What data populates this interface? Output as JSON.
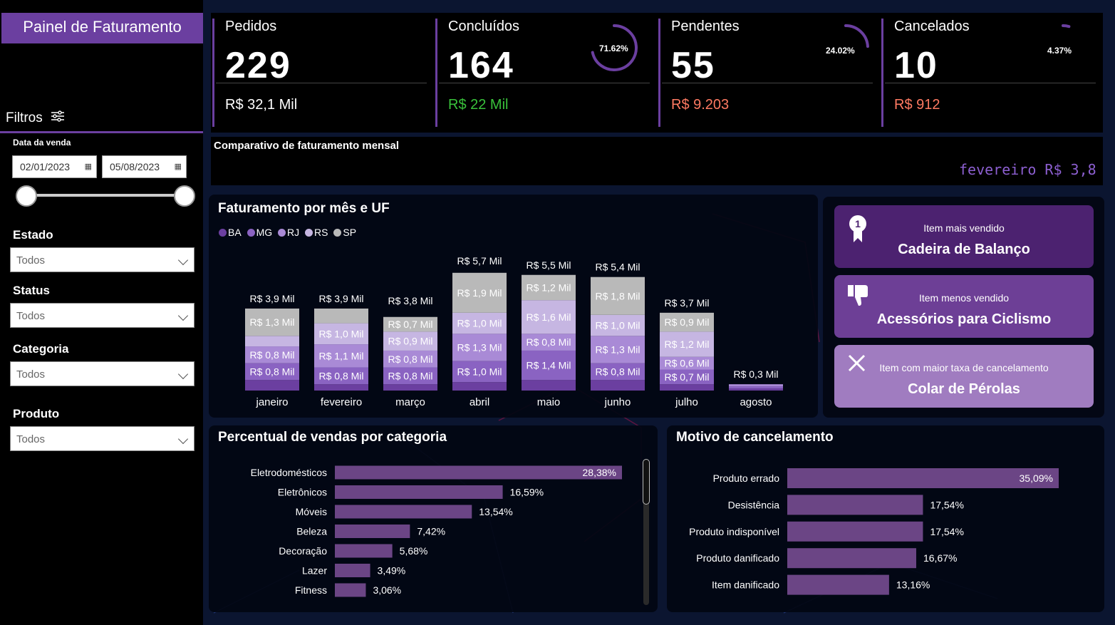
{
  "app": {
    "title": "Painel de Faturamento"
  },
  "filters": {
    "heading": "Filtros",
    "date_label": "Data da venda",
    "date_start": "02/01/2023",
    "date_end": "05/08/2023",
    "fields": [
      {
        "label": "Estado",
        "value": "Todos"
      },
      {
        "label": "Status",
        "value": "Todos"
      },
      {
        "label": "Categoria",
        "value": "Todos"
      },
      {
        "label": "Produto",
        "value": "Todos"
      }
    ]
  },
  "kpis": [
    {
      "title": "Pedidos",
      "value": "229",
      "money": "R$ 32,1 Mil",
      "money_color": "#ffffff",
      "pct": "",
      "fraction": 0
    },
    {
      "title": "Concluídos",
      "value": "164",
      "money": "R$ 22 Mil",
      "money_color": "#39c23b",
      "pct": "71.62%",
      "fraction": 0.7162
    },
    {
      "title": "Pendentes",
      "value": "55",
      "money": "R$ 9.203",
      "money_color": "#ff7a62",
      "pct": "24.02%",
      "fraction": 0.2402
    },
    {
      "title": "Cancelados",
      "value": "10",
      "money": "R$ 912",
      "money_color": "#ff7a62",
      "pct": "4.37%",
      "fraction": 0.0437
    }
  ],
  "comparativo": {
    "title": "Comparativo de faturamento mensal",
    "ticker": "fevereiro R$ 3,8"
  },
  "fat_chart": {
    "title": "Faturamento por mês e UF",
    "legend": [
      {
        "name": "BA",
        "color": "#6b3fa0"
      },
      {
        "name": "MG",
        "color": "#8a63c2"
      },
      {
        "name": "RJ",
        "color": "#a98ad6"
      },
      {
        "name": "RS",
        "color": "#c6b6e2"
      },
      {
        "name": "SP",
        "color": "#b9b9b9"
      }
    ]
  },
  "chart_data": [
    {
      "type": "bar",
      "title": "Faturamento por mês e UF",
      "categories": [
        "janeiro",
        "fevereiro",
        "março",
        "abril",
        "maio",
        "junho",
        "julho",
        "agosto"
      ],
      "totals": [
        "R$ 3,9 Mil",
        "R$ 3,9 Mil",
        "R$ 3,8 Mil",
        "R$ 5,7 Mil",
        "R$ 5,5 Mil",
        "R$ 5,4 Mil",
        "R$ 3,7 Mil",
        "R$ 0,3 Mil"
      ],
      "total_values": [
        3.9,
        3.9,
        3.8,
        5.7,
        5.5,
        5.4,
        3.7,
        0.3
      ],
      "series": [
        {
          "name": "BA",
          "values": [
            0.5,
            0.3,
            0.3,
            0.4,
            0.5,
            0.5,
            0.3,
            0.1
          ],
          "labels": [
            "",
            "",
            "",
            "",
            "",
            "",
            "",
            ""
          ]
        },
        {
          "name": "MG",
          "values": [
            0.8,
            0.8,
            0.8,
            1.0,
            1.4,
            0.8,
            0.7,
            0.1
          ],
          "labels": [
            "R$ 0,8 Mil",
            "R$ 0,8 Mil",
            "R$ 0,8 Mil",
            "R$ 1,0 Mil",
            "R$ 1,4 Mil",
            "R$ 0,8 Mil",
            "R$ 0,7 Mil",
            ""
          ]
        },
        {
          "name": "RJ",
          "values": [
            0.8,
            1.1,
            0.8,
            1.3,
            0.8,
            1.3,
            0.6,
            0.1
          ],
          "labels": [
            "R$ 0,8 Mil",
            "R$ 1,1 Mil",
            "R$ 0,8 Mil",
            "R$ 1,3 Mil",
            "R$ 0,8 Mil",
            "R$ 1,3 Mil",
            "R$ 0,6 Mil",
            ""
          ]
        },
        {
          "name": "RS",
          "values": [
            0.5,
            1.0,
            0.9,
            1.0,
            1.6,
            1.0,
            1.2,
            0.0
          ],
          "labels": [
            "",
            "R$ 1,0 Mil",
            "R$ 0,9 Mil",
            "R$ 1,0 Mil",
            "R$ 1,6 Mil",
            "R$ 1,0 Mil",
            "R$ 1,2 Mil",
            ""
          ]
        },
        {
          "name": "SP",
          "values": [
            1.3,
            0.7,
            0.7,
            1.9,
            1.2,
            1.8,
            0.9,
            0.0
          ],
          "labels": [
            "R$ 1,3 Mil",
            "",
            "R$ 0,7 Mil",
            "R$ 1,9 Mil",
            "R$ 1,2 Mil",
            "R$ 1,8 Mil",
            "R$ 0,9 Mil",
            ""
          ]
        }
      ],
      "ylabel": "",
      "xlabel": ""
    },
    {
      "type": "bar",
      "orientation": "horizontal",
      "title": "Percentual de vendas por categoria",
      "categories": [
        "Eletrodomésticos",
        "Eletrônicos",
        "Móveis",
        "Beleza",
        "Decoração",
        "Lazer",
        "Fitness"
      ],
      "values": [
        28.38,
        16.59,
        13.54,
        7.42,
        5.68,
        3.49,
        3.06
      ],
      "labels": [
        "28,38%",
        "16,59%",
        "13,54%",
        "7,42%",
        "5,68%",
        "3,49%",
        "3,06%"
      ]
    },
    {
      "type": "bar",
      "orientation": "horizontal",
      "title": "Motivo de cancelamento",
      "categories": [
        "Produto errado",
        "Desistência",
        "Produto indisponível",
        "Produto danificado",
        "Item danificado"
      ],
      "values": [
        35.09,
        17.54,
        17.54,
        16.67,
        13.16
      ],
      "labels": [
        "35,09%",
        "17,54%",
        "17,54%",
        "16,67%",
        "13,16%"
      ]
    }
  ],
  "cards": [
    {
      "subtitle": "Item mais vendido",
      "value": "Cadeira de Balanço",
      "color": "#4c2270",
      "icon": "medal-icon"
    },
    {
      "subtitle": "Item menos vendido",
      "value": "Acessórios para Ciclismo",
      "color": "#6d3f96",
      "icon": "thumbs-down-icon"
    },
    {
      "subtitle": "Item com maior taxa de cancelamento",
      "value": "Colar de Pérolas",
      "color": "#a07cc0",
      "icon": "close-icon"
    }
  ],
  "colors": {
    "accent": "#6b3fa0",
    "bar": "#6b4585",
    "background": "#0b1530"
  }
}
